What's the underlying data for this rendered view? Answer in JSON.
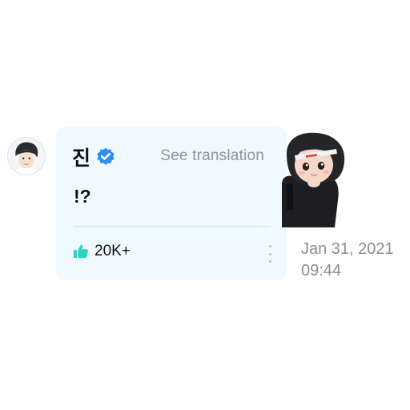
{
  "post": {
    "author": "진",
    "verified": true,
    "translate_label": "See translation",
    "message": "!?",
    "likes": "20K+",
    "date": "Jan 31, 2021",
    "time": "09:44"
  },
  "icons": {
    "verified": "verified-badge-icon",
    "like": "thumbs-up-icon",
    "more": "vertical-ellipsis-icon"
  },
  "colors": {
    "bubble_bg": "#eefafd",
    "verified_blue": "#2f8ff0",
    "like_teal": "#2ed3c2",
    "muted_text": "#8e9498"
  }
}
